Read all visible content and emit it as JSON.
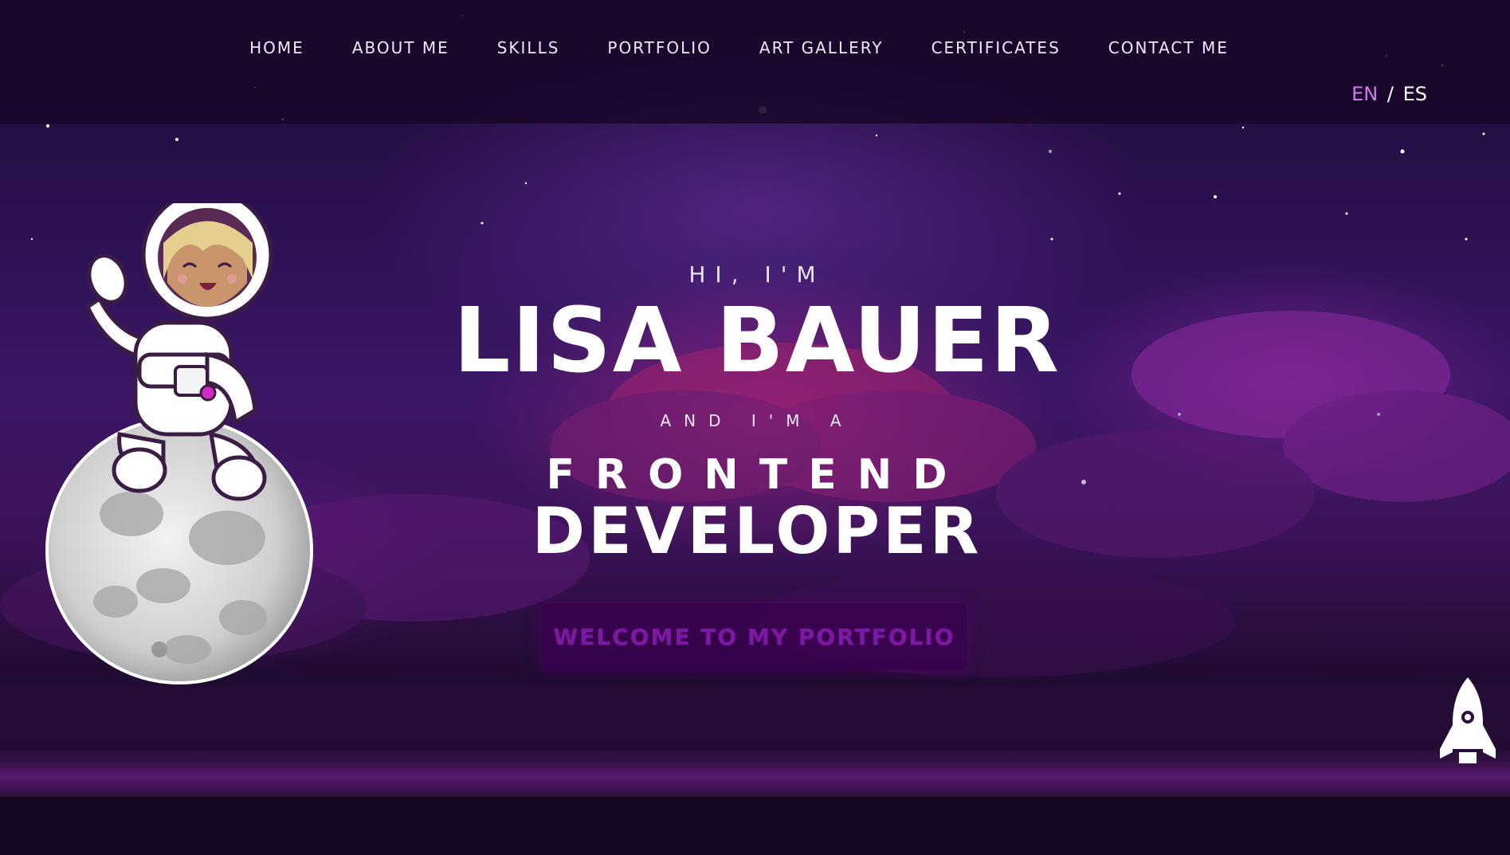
{
  "nav": {
    "items": [
      {
        "label": "HOME"
      },
      {
        "label": "ABOUT ME"
      },
      {
        "label": "SKILLS"
      },
      {
        "label": "PORTFOLIO"
      },
      {
        "label": "ART GALLERY"
      },
      {
        "label": "CERTIFICATES"
      },
      {
        "label": "CONTACT ME"
      }
    ]
  },
  "language": {
    "active": "EN",
    "separator": "/",
    "other": "ES"
  },
  "hero": {
    "greeting": "HI, I'M",
    "name": "LISA BAUER",
    "subtitle": "AND I'M A",
    "role_line1": "FRONTEND",
    "role_line2": "DEVELOPER",
    "cta_label": "WELCOME TO MY PORTFOLIO"
  },
  "colors": {
    "accent": "#d07be8",
    "cta_background": "#3c0050",
    "cta_text": "#7a1aa3",
    "nav_background": "#180628"
  },
  "icons": {
    "character": "astronaut-on-moon-icon",
    "scroll_top": "rocket-icon"
  }
}
